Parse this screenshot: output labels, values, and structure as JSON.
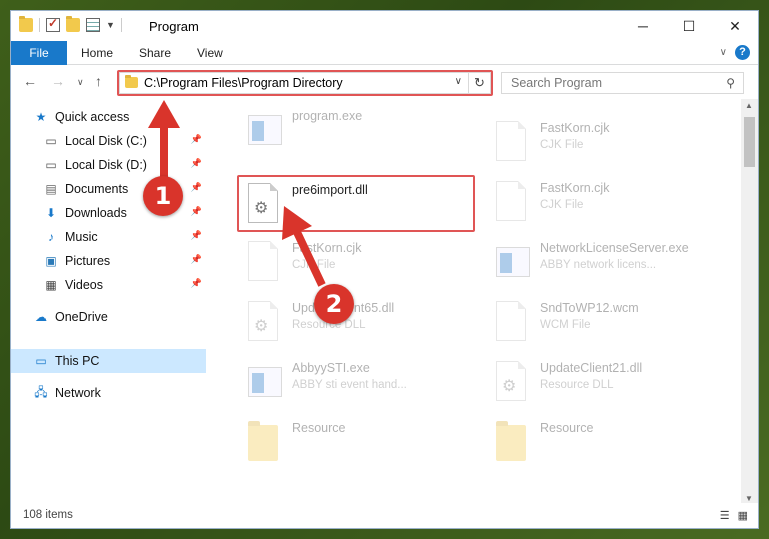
{
  "window": {
    "title": "Program"
  },
  "ribbon": {
    "tabs": [
      "File",
      "Home",
      "Share",
      "View"
    ]
  },
  "address": {
    "path": "C:\\Program Files\\Program Directory"
  },
  "search": {
    "placeholder": "Search Program"
  },
  "nav": {
    "items": [
      {
        "label": "Quick access",
        "icon": "star-icon"
      },
      {
        "label": "Local Disk (C:)",
        "icon": "drive-icon",
        "pinned": true
      },
      {
        "label": "Local Disk (D:)",
        "icon": "drive-icon",
        "pinned": true
      },
      {
        "label": "Documents",
        "icon": "documents-icon",
        "pinned": true
      },
      {
        "label": "Downloads",
        "icon": "download-icon",
        "pinned": true
      },
      {
        "label": "Music",
        "icon": "music-icon",
        "pinned": true
      },
      {
        "label": "Pictures",
        "icon": "pictures-icon",
        "pinned": true
      },
      {
        "label": "Videos",
        "icon": "videos-icon",
        "pinned": true
      },
      {
        "label": "OneDrive",
        "icon": "cloud-icon"
      },
      {
        "label": "This PC",
        "icon": "computer-icon",
        "selected": true
      },
      {
        "label": "Network",
        "icon": "network-icon"
      }
    ]
  },
  "files": {
    "left": [
      {
        "name": "program.exe",
        "type": ""
      },
      {
        "name": "pre6import.dll",
        "type": ""
      },
      {
        "name": "FastKorn.cjk",
        "type": "CJK File"
      },
      {
        "name": "UpdateClient65.dll",
        "type": "Resource DLL"
      },
      {
        "name": "AbbyySTI.exe",
        "type": "ABBY sti event hand..."
      },
      {
        "name": "Resource",
        "type": ""
      }
    ],
    "right": [
      {
        "name": "FastKorn.cjk",
        "type": "CJK File"
      },
      {
        "name": "FastKorn.cjk",
        "type": "CJK File"
      },
      {
        "name": "NetworkLicenseServer.exe",
        "type": "ABBY network licens..."
      },
      {
        "name": "SndToWP12.wcm",
        "type": "WCM File"
      },
      {
        "name": "UpdateClient21.dll",
        "type": "Resource DLL"
      },
      {
        "name": "Resource",
        "type": ""
      }
    ]
  },
  "status": {
    "count": "108 items"
  },
  "annotations": {
    "step1": "1",
    "step2": "2"
  },
  "colors": {
    "accent": "#1979ca",
    "highlight": "#e05555",
    "badge": "#d9342b",
    "selected": "#cce8ff"
  }
}
